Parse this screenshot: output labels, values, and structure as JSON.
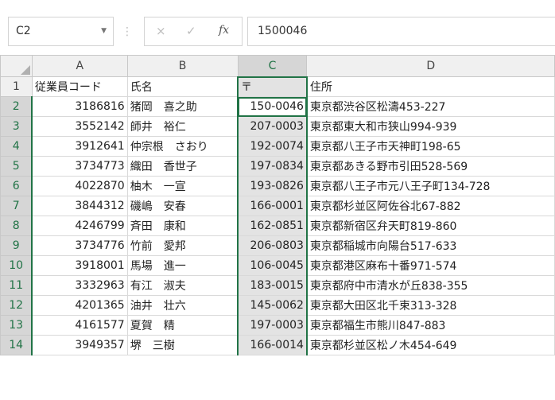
{
  "formula_bar": {
    "name_box": "C2",
    "formula": "1500046",
    "cancel_icon": "×",
    "enter_icon": "✓",
    "fx_icon": "fx"
  },
  "columns": [
    "A",
    "B",
    "C",
    "D"
  ],
  "header_row": {
    "row_number": "1",
    "a": "従業員コード",
    "b": "氏名",
    "c": "〒",
    "d": "住所"
  },
  "rows": [
    {
      "n": "2",
      "code": "3186816",
      "name": "猪岡　喜之助",
      "zip": "150-0046",
      "addr": "東京都渋谷区松濤453-227"
    },
    {
      "n": "3",
      "code": "3552142",
      "name": "師井　裕仁",
      "zip": "207-0003",
      "addr": "東京都東大和市狭山994-939"
    },
    {
      "n": "4",
      "code": "3912641",
      "name": "仲宗根　さおり",
      "zip": "192-0074",
      "addr": "東京都八王子市天神町198-65"
    },
    {
      "n": "5",
      "code": "3734773",
      "name": "織田　香世子",
      "zip": "197-0834",
      "addr": "東京都あきる野市引田528-569"
    },
    {
      "n": "6",
      "code": "4022870",
      "name": "柚木　一宣",
      "zip": "193-0826",
      "addr": "東京都八王子市元八王子町134-728"
    },
    {
      "n": "7",
      "code": "3844312",
      "name": "磯嶋　安春",
      "zip": "166-0001",
      "addr": "東京都杉並区阿佐谷北67-882"
    },
    {
      "n": "8",
      "code": "4246799",
      "name": "斉田　康和",
      "zip": "162-0851",
      "addr": "東京都新宿区弁天町819-860"
    },
    {
      "n": "9",
      "code": "3734776",
      "name": "竹前　愛邦",
      "zip": "206-0803",
      "addr": "東京都稲城市向陽台517-633"
    },
    {
      "n": "10",
      "code": "3918001",
      "name": "馬場　進一",
      "zip": "106-0045",
      "addr": "東京都港区麻布十番971-574"
    },
    {
      "n": "11",
      "code": "3332963",
      "name": "有江　淑夫",
      "zip": "183-0015",
      "addr": "東京都府中市清水が丘838-355"
    },
    {
      "n": "12",
      "code": "4201365",
      "name": "油井　壮六",
      "zip": "145-0062",
      "addr": "東京都大田区北千束313-328"
    },
    {
      "n": "13",
      "code": "4161577",
      "name": "夏賀　精",
      "zip": "197-0003",
      "addr": "東京都福生市熊川847-883"
    },
    {
      "n": "14",
      "code": "3949357",
      "name": "堺　三樹",
      "zip": "166-0014",
      "addr": "東京都杉並区松ノ木454-649"
    }
  ],
  "colors": {
    "accent_green": "#217346",
    "selected_header": "#d6d6d6",
    "selected_column_fill": "#e3e3e3"
  }
}
